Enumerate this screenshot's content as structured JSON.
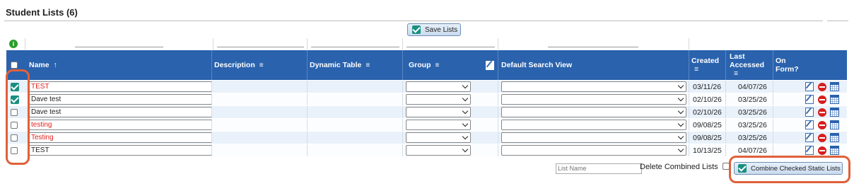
{
  "page": {
    "title": "Student Lists (6)"
  },
  "toolbar": {
    "save_label": "Save Lists"
  },
  "table": {
    "columns": {
      "name": "Name",
      "name_sort": "↑",
      "description": "Description",
      "dynamic_table": "Dynamic Table",
      "group": "Group",
      "default_search_view": "Default Search View",
      "created": "Created",
      "last_accessed_1": "Last",
      "last_accessed_2": "Accessed",
      "on_form_1": "On",
      "on_form_2": "Form?",
      "menu_glyph": "≡"
    },
    "rows": [
      {
        "checked": true,
        "name": "TEST",
        "name_color": "red",
        "created": "03/11/26",
        "last_accessed": "04/07/26"
      },
      {
        "checked": true,
        "name": "Dave test",
        "name_color": "black",
        "created": "02/10/26",
        "last_accessed": "03/25/26"
      },
      {
        "checked": false,
        "name": "Dave test",
        "name_color": "black",
        "created": "02/10/26",
        "last_accessed": "03/25/26"
      },
      {
        "checked": false,
        "name": "testing",
        "name_color": "red",
        "created": "09/08/25",
        "last_accessed": "03/25/26"
      },
      {
        "checked": false,
        "name": "Testing",
        "name_color": "red",
        "created": "09/08/25",
        "last_accessed": "03/25/26"
      },
      {
        "checked": false,
        "name": "TEST",
        "name_color": "black",
        "created": "10/13/25",
        "last_accessed": "04/07/26"
      }
    ]
  },
  "footer": {
    "list_name_placeholder": "List Name",
    "delete_combined_label": "Delete Combined Lists",
    "combine_label": "Combine Checked Static Lists"
  },
  "colors": {
    "header_bg": "#2a62ad",
    "highlight": "#e0603a",
    "red_text": "#e0201c"
  },
  "icons": [
    "info-icon",
    "checkbox-icon",
    "sort-up-icon",
    "menu-icon",
    "edit-icon",
    "delete-icon",
    "calendar-icon"
  ]
}
